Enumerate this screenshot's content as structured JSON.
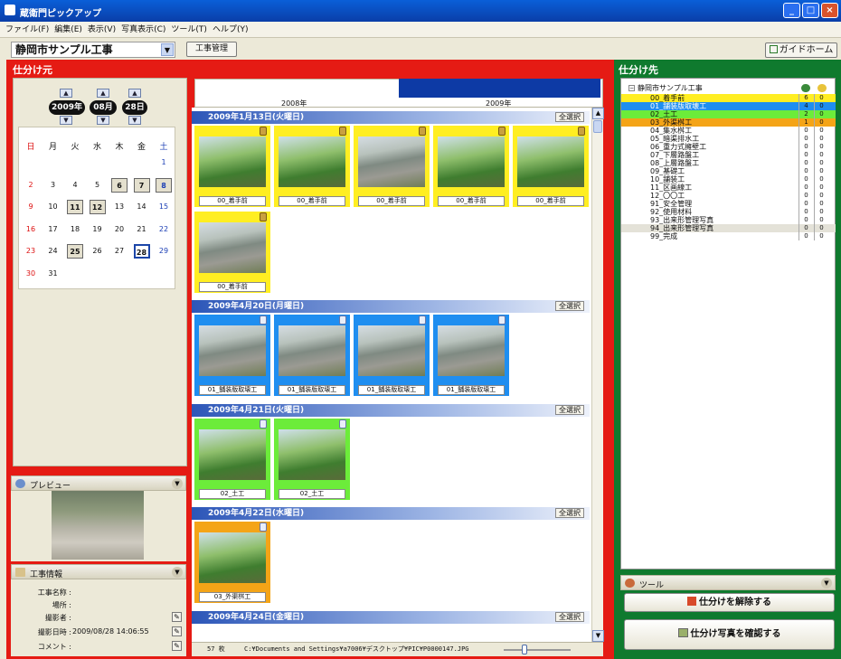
{
  "window": {
    "title": "蔵衛門ピックアップ",
    "controls": [
      "_",
      "□",
      "×"
    ]
  },
  "menu": [
    "ファイル(F)",
    "編集(E)",
    "表示(V)",
    "写真表示(C)",
    "ツール(T)",
    "ヘルプ(Y)"
  ],
  "project": {
    "name": "静岡市サンプル工事",
    "manage_label": "工事管理",
    "guide_label": "ガイドホーム"
  },
  "left": {
    "title": "仕分け元"
  },
  "right": {
    "title": "仕分け先"
  },
  "calendar": {
    "year": "2009年",
    "month": "08月",
    "day": "28日",
    "weekdays": [
      "日",
      "月",
      "火",
      "水",
      "木",
      "金",
      "土"
    ],
    "weeks": [
      [
        "",
        "",
        "",
        "",
        "",
        "",
        "1"
      ],
      [
        "2",
        "3",
        "4",
        "5",
        "6",
        "7",
        "8"
      ],
      [
        "9",
        "10",
        "11",
        "12",
        "13",
        "14",
        "15"
      ],
      [
        "16",
        "17",
        "18",
        "19",
        "20",
        "21",
        "22"
      ],
      [
        "23",
        "24",
        "25",
        "26",
        "27",
        "28",
        "29"
      ],
      [
        "30",
        "31",
        "",
        "",
        "",
        "",
        ""
      ]
    ]
  },
  "timeline": {
    "year1": "2008年",
    "year2": "2009年"
  },
  "groups": [
    {
      "date": "2009年1月13日(火曜日)",
      "select_all": "全選択",
      "photos": [
        "00_着手前",
        "00_着手前",
        "00_着手前",
        "00_着手前",
        "00_着手前",
        "00_着手前"
      ]
    },
    {
      "date": "2009年4月20日(月曜日)",
      "select_all": "全選択",
      "photos": [
        "01_舗装版取壊工",
        "01_舗装版取壊工",
        "01_舗装版取壊工",
        "01_舗装版取壊工"
      ]
    },
    {
      "date": "2009年4月21日(火曜日)",
      "select_all": "全選択",
      "photos": [
        "02_土工",
        "02_土工"
      ]
    },
    {
      "date": "2009年4月22日(水曜日)",
      "select_all": "全選択",
      "photos": [
        "03_外渠桝工"
      ]
    },
    {
      "date": "2009年4月24日(金曜日)",
      "select_all": "全選択",
      "photos": []
    }
  ],
  "status": {
    "count": "57 枚",
    "path": "C:¥Documents and Settings¥a7006¥デスクトップ¥PIC¥P0000147.JPG"
  },
  "preview": {
    "label": "プレビュー"
  },
  "project_info": {
    "label": "工事情報",
    "fields": [
      {
        "label": "工事名称 :",
        "value": ""
      },
      {
        "label": "場所 :",
        "value": ""
      },
      {
        "label": "撮影者 :",
        "value": ""
      },
      {
        "label": "撮影日時 :",
        "value": "2009/08/28 14:06:55"
      },
      {
        "label": "コメント :",
        "value": ""
      }
    ]
  },
  "tree": {
    "root": "静岡市サンプル工事",
    "items": [
      {
        "name": "00_着手前",
        "c1": "6",
        "c2": "0",
        "color": "#ffee22"
      },
      {
        "name": "01_舗装版取壊工",
        "c1": "4",
        "c2": "0",
        "color": "#1f8ef0"
      },
      {
        "name": "02_土工",
        "c1": "2",
        "c2": "0",
        "color": "#6cec3a"
      },
      {
        "name": "03_外渠桝工",
        "c1": "1",
        "c2": "0",
        "color": "#f4a417"
      },
      {
        "name": "04_集水桝工",
        "c1": "0",
        "c2": "0",
        "color": ""
      },
      {
        "name": "05_暗渠排水工",
        "c1": "0",
        "c2": "0",
        "color": ""
      },
      {
        "name": "06_重力式擁壁工",
        "c1": "0",
        "c2": "0",
        "color": ""
      },
      {
        "name": "07_下層路盤工",
        "c1": "0",
        "c2": "0",
        "color": ""
      },
      {
        "name": "08_上層路盤工",
        "c1": "0",
        "c2": "0",
        "color": ""
      },
      {
        "name": "09_基礎工",
        "c1": "0",
        "c2": "0",
        "color": ""
      },
      {
        "name": "10_舗装工",
        "c1": "0",
        "c2": "0",
        "color": ""
      },
      {
        "name": "11_区画線工",
        "c1": "0",
        "c2": "0",
        "color": ""
      },
      {
        "name": "12_〇〇工",
        "c1": "0",
        "c2": "0",
        "color": ""
      },
      {
        "name": "91_安全管理",
        "c1": "0",
        "c2": "0",
        "color": ""
      },
      {
        "name": "92_使用材料",
        "c1": "0",
        "c2": "0",
        "color": ""
      },
      {
        "name": "93_出来形管理写真",
        "c1": "0",
        "c2": "0",
        "color": ""
      },
      {
        "name": "94_出来形管理写真",
        "c1": "0",
        "c2": "0",
        "color": "#e4e2d8"
      },
      {
        "name": "99_完成",
        "c1": "0",
        "c2": "0",
        "color": ""
      }
    ]
  },
  "tools": {
    "label": "ツール",
    "release_label": "仕分けを解除する",
    "confirm_label": "仕分け写真を確認する"
  }
}
